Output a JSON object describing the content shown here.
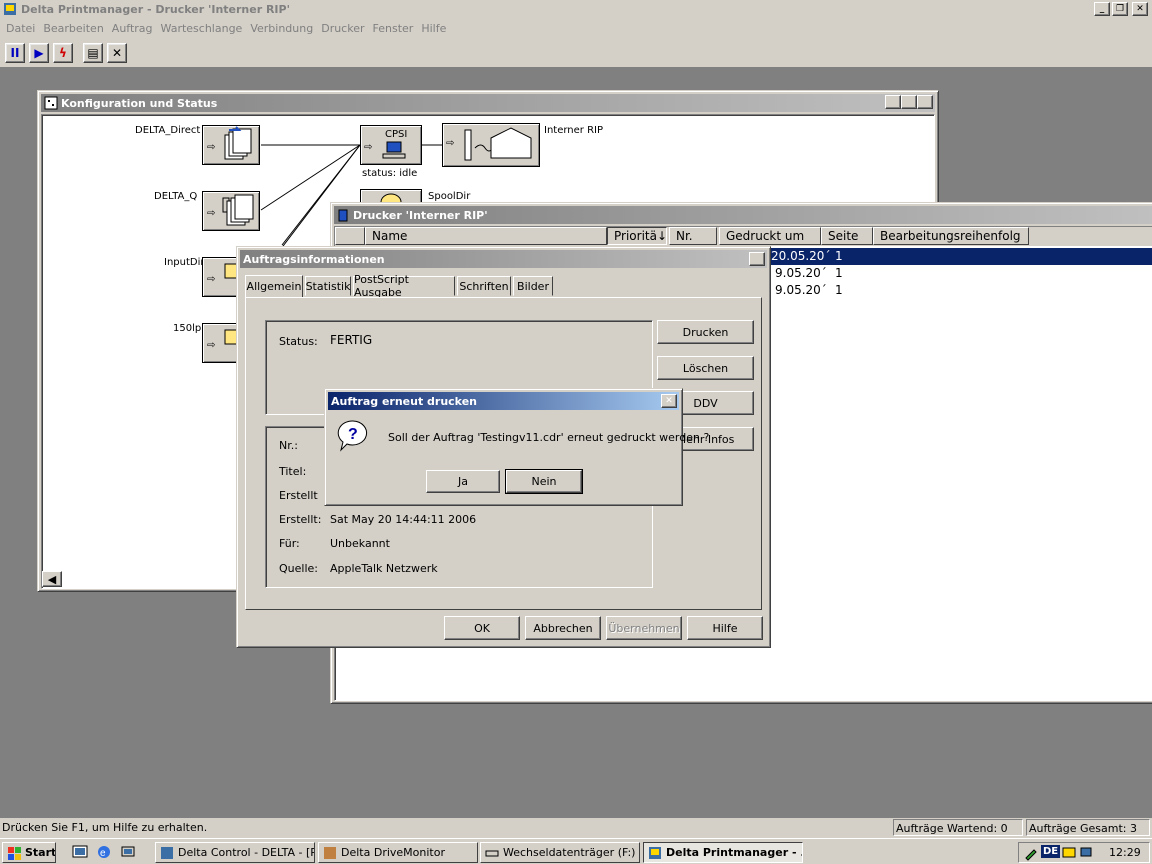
{
  "app": {
    "title": "Delta Printmanager - Drucker 'Interner RIP'"
  },
  "menu": [
    "Datei",
    "Bearbeiten",
    "Auftrag",
    "Warteschlange",
    "Verbindung",
    "Drucker",
    "Fenster",
    "Hilfe"
  ],
  "config_window": {
    "title": "Konfiguration und Status",
    "inputs": [
      "DELTA_Direct",
      "DELTA_Q",
      "InputDir",
      "150lpi"
    ],
    "cpsi_label": "CPSI",
    "cpsi_status": "status: idle",
    "printer_label": "Interner RIP",
    "spool_label": "SpoolDir"
  },
  "printer_window": {
    "title": "Drucker 'Interner RIP'",
    "columns": [
      "Name",
      "Prioritä↓",
      "Nr.",
      "Gedruckt um",
      "Seite",
      "Bearbeitungsreihenfolg"
    ],
    "rows": [
      {
        "date": "20.05.20´",
        "page": "1"
      },
      {
        "date": "9.05.20´",
        "page": "1"
      },
      {
        "date": "9.05.20´",
        "page": "1"
      }
    ]
  },
  "job_dialog": {
    "title": "Auftragsinformationen",
    "tabs": [
      "Allgemein",
      "Statistik",
      "PostScript Ausgabe",
      "Schriften",
      "Bilder"
    ],
    "status_label": "Status:",
    "status_value": "FERTIG",
    "side_buttons": [
      "Drucken",
      "Löschen",
      "DDV",
      "Mehr Infos"
    ],
    "fields": [
      {
        "label": "Nr.:",
        "value": ""
      },
      {
        "label": "Titel:",
        "value": ""
      },
      {
        "label": "Erstellt",
        "value": ""
      },
      {
        "label": "Erstellt:",
        "value": "Sat May 20 14:44:11 2006"
      },
      {
        "label": "Für:",
        "value": "Unbekannt"
      },
      {
        "label": "Quelle:",
        "value": "AppleTalk Netzwerk"
      }
    ],
    "buttons": {
      "ok": "OK",
      "cancel": "Abbrechen",
      "apply": "Übernehmen",
      "help": "Hilfe"
    }
  },
  "confirm_dialog": {
    "title": "Auftrag erneut drucken",
    "message": "Soll der Auftrag 'Testingv11.cdr' erneut gedruckt werden  ?",
    "yes": "Ja",
    "no": "Nein"
  },
  "statusbar": {
    "hint": "Drücken Sie F1, um Hilfe zu erhalten.",
    "waiting": "Aufträge Wartend: 0",
    "total": "Aufträge Gesamt: 3"
  },
  "taskbar": {
    "start": "Start",
    "tasks": [
      "Delta Control - DELTA - [P...",
      "Delta DriveMonitor",
      "Wechseldatenträger (F:)",
      "Delta Printmanager - ..."
    ],
    "lang": "DE",
    "clock": "12:29"
  }
}
